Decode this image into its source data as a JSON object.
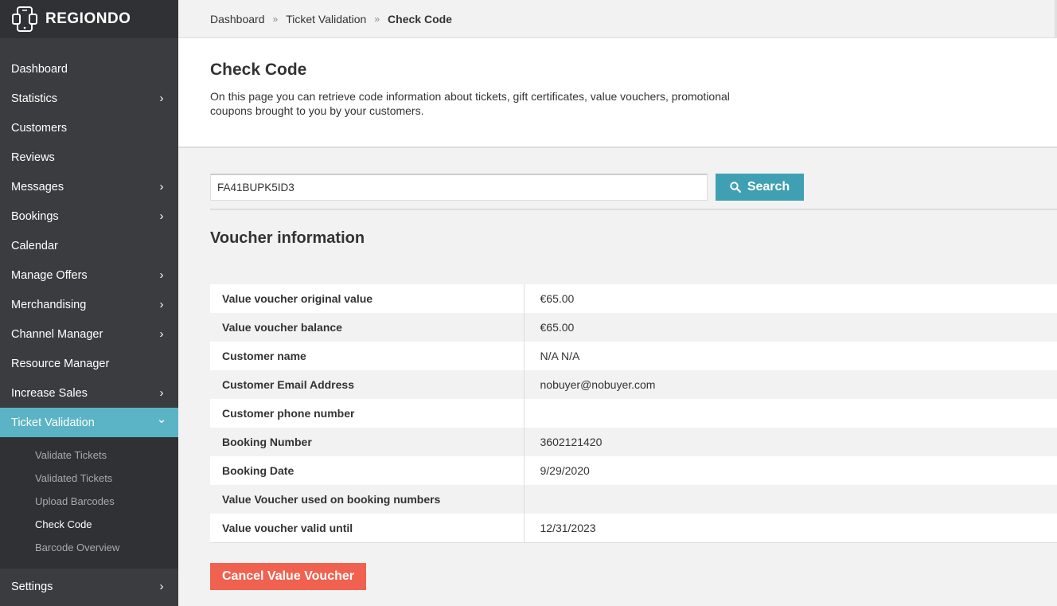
{
  "brand": {
    "name": "REGIONDO"
  },
  "sidebar": {
    "items": [
      {
        "label": "Dashboard",
        "chevron": false
      },
      {
        "label": "Statistics",
        "chevron": true
      },
      {
        "label": "Customers",
        "chevron": false
      },
      {
        "label": "Reviews",
        "chevron": false
      },
      {
        "label": "Messages",
        "chevron": true
      },
      {
        "label": "Bookings",
        "chevron": true
      },
      {
        "label": "Calendar",
        "chevron": false
      },
      {
        "label": "Manage Offers",
        "chevron": true
      },
      {
        "label": "Merchandising",
        "chevron": true
      },
      {
        "label": "Channel Manager",
        "chevron": true
      },
      {
        "label": "Resource Manager",
        "chevron": false
      },
      {
        "label": "Increase Sales",
        "chevron": true
      },
      {
        "label": "Ticket Validation",
        "chevron": true,
        "active": true
      }
    ],
    "subitems": [
      {
        "label": "Validate Tickets"
      },
      {
        "label": "Validated Tickets"
      },
      {
        "label": "Upload Barcodes"
      },
      {
        "label": "Check Code",
        "current": true
      },
      {
        "label": "Barcode Overview"
      }
    ],
    "settings": {
      "label": "Settings"
    }
  },
  "breadcrumb": {
    "items": [
      "Dashboard",
      "Ticket Validation",
      "Check Code"
    ],
    "separator": "»"
  },
  "header": {
    "title": "Check Code",
    "description": "On this page you can retrieve code information about tickets, gift certificates, value vouchers, promotional coupons brought to you by your customers."
  },
  "search": {
    "value": "FA41BUPK5ID3",
    "button_label": "Search"
  },
  "voucher": {
    "title": "Voucher information",
    "rows": [
      {
        "key": "Value voucher original value",
        "value": "€65.00"
      },
      {
        "key": "Value voucher balance",
        "value": "€65.00"
      },
      {
        "key": "Customer name",
        "value": "N/A N/A"
      },
      {
        "key": "Customer Email Address",
        "value": "nobuyer@nobuyer.com"
      },
      {
        "key": "Customer phone number",
        "value": ""
      },
      {
        "key": "Booking Number",
        "value": "3602121420"
      },
      {
        "key": "Booking Date",
        "value": "9/29/2020"
      },
      {
        "key": "Value Voucher used on booking numbers",
        "value": ""
      },
      {
        "key": "Value voucher valid until",
        "value": "12/31/2023"
      }
    ],
    "cancel_label": "Cancel Value Voucher"
  },
  "colors": {
    "sidebar_bg": "#3a3c3f",
    "active": "#5bb4c5",
    "search_button": "#3fa0b3",
    "cancel_button": "#f0624f"
  }
}
